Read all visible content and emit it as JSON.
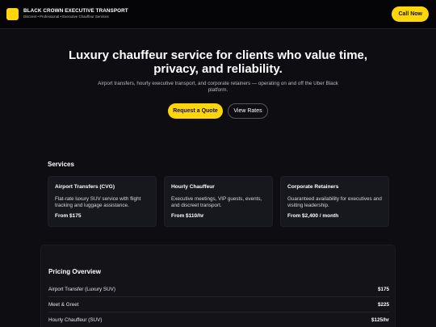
{
  "header": {
    "brand_name": "BLACK CROWN EXECUTIVE TRANSPORT",
    "tagline": "Discreet • Professional • Executive Chauffeur Services",
    "call_label": "Call Now"
  },
  "hero": {
    "title": "Luxury chauffeur service for clients who value time, privacy, and reliability.",
    "subtitle": "Airport transfers, hourly executive transport, and corporate retainers — operating on and off the Uber Black platform.",
    "quote_label": "Request a Quote",
    "rates_label": "View Rates"
  },
  "services": {
    "title": "Services",
    "items": [
      {
        "title": "Airport Transfers (CVG)",
        "desc": "Flat-rate luxury SUV service with flight tracking and luggage assistance.",
        "price": "From $175"
      },
      {
        "title": "Hourly Chauffeur",
        "desc": "Executive meetings, VIP guests, events, and discreet transport.",
        "price": "From $110/hr"
      },
      {
        "title": "Corporate Retainers",
        "desc": "Guaranteed availability for executives and visiting leadership.",
        "price": "From $2,400 / month"
      }
    ]
  },
  "pricing": {
    "title": "Pricing Overview",
    "rows": [
      {
        "label": "Airport Transfer (Luxury SUV)",
        "value": "$175"
      },
      {
        "label": "Meet & Greet",
        "value": "$225"
      },
      {
        "label": "Hourly Chauffeur (SUV)",
        "value": "$125/hr"
      }
    ]
  },
  "colors": {
    "accent": "#ffd60a",
    "background": "#0e0e12",
    "card": "#17171e"
  }
}
